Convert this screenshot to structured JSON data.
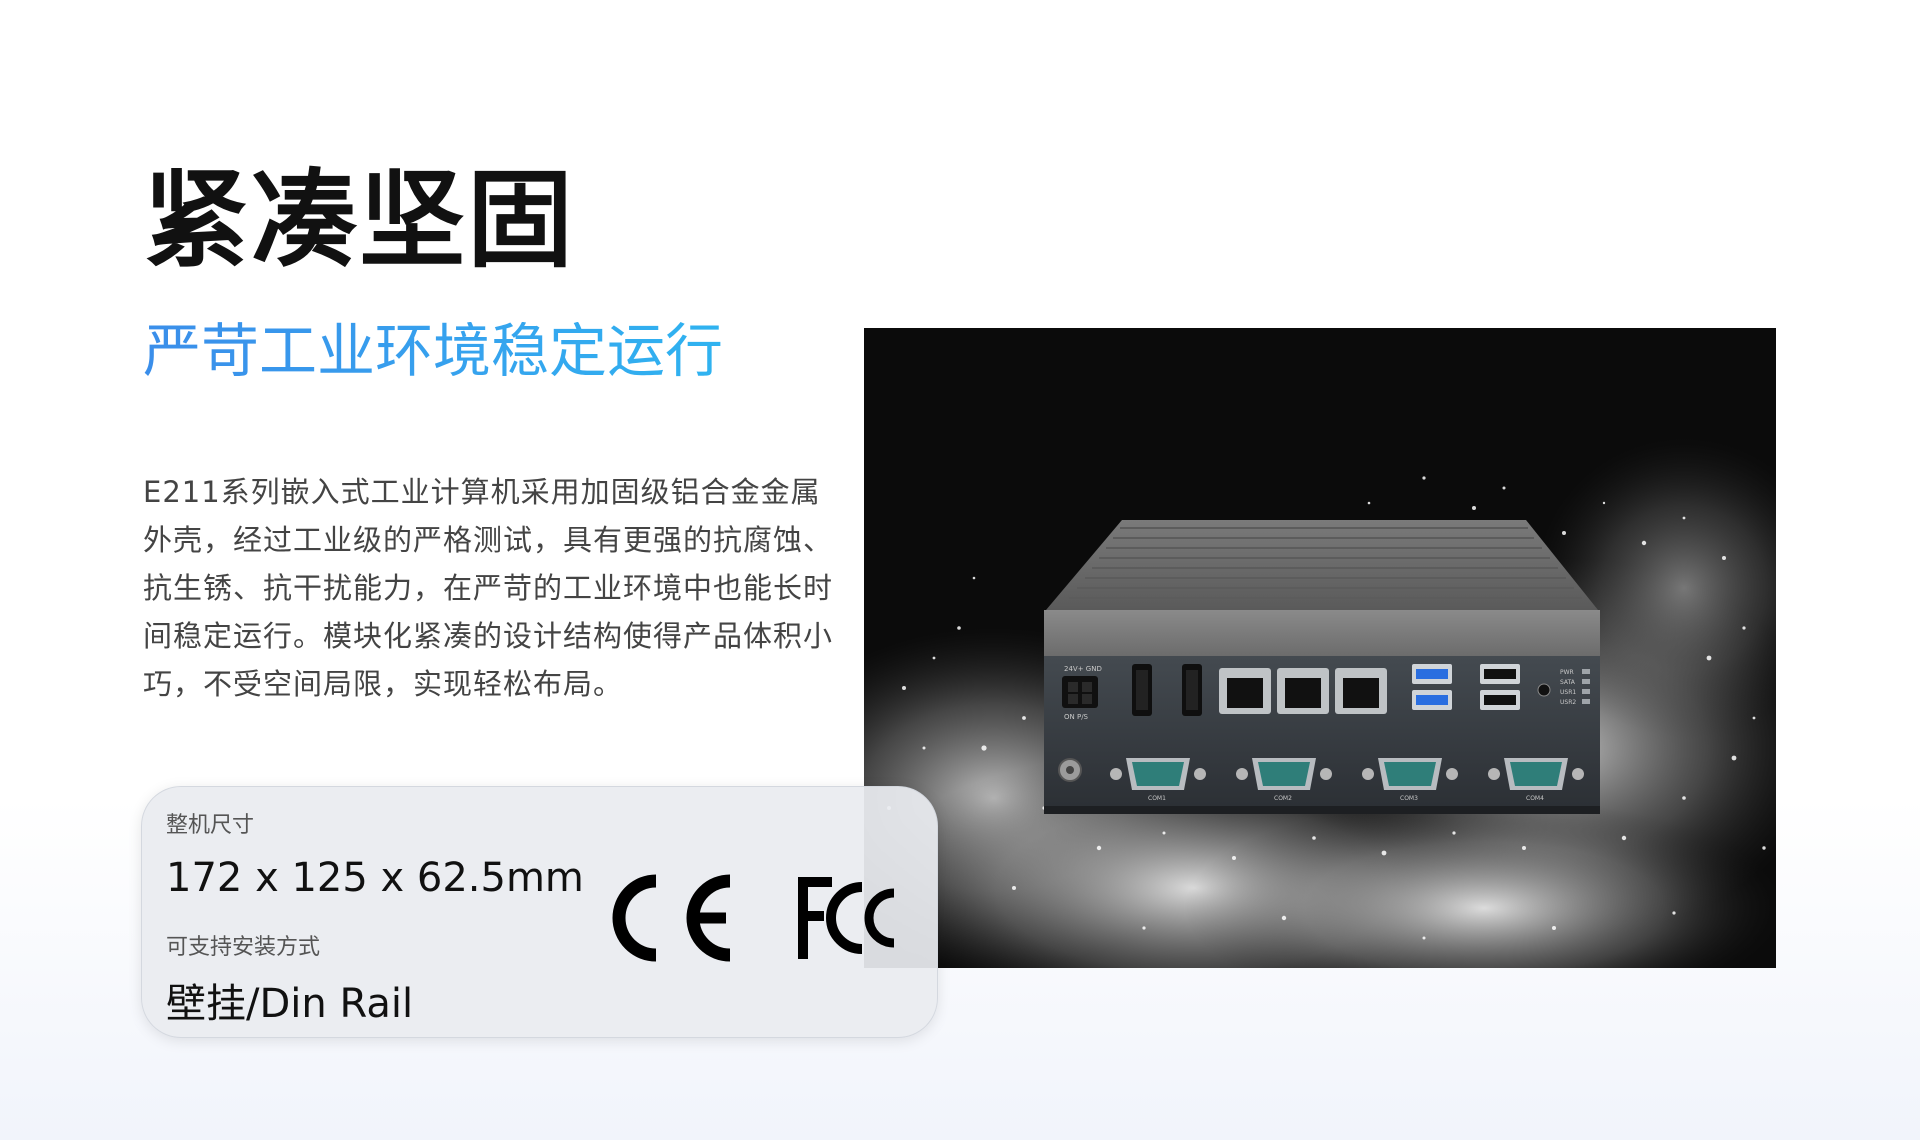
{
  "hero": {
    "title": "紧凑坚固",
    "subtitle": "严苛工业环境稳定运行",
    "description": "E211系列嵌入式工业计算机采用加固级铝合金金属外壳，经过工业级的严格测试，具有更强的抗腐蚀、抗生锈、抗干扰能力，在严苛的工业环境中也能长时间稳定运行。模块化紧凑的设计结构使得产品体积小巧，不受空间局限，实现轻松布局。"
  },
  "specs": {
    "size_label": "整机尺寸",
    "size_value": "172 x 125 x 62.5mm",
    "mount_label": "可支持安装方式",
    "mount_value": "壁挂/Din Rail"
  },
  "certifications": {
    "ce": "ce-logo",
    "fcc": "fcc-logo"
  },
  "product_image": {
    "port_labels": {
      "power_top": "24V+  GND",
      "power_bottom": "ON    P/S",
      "leds": [
        "PWR",
        "SATA",
        "USR1",
        "USR2"
      ],
      "com": [
        "COM1",
        "COM2",
        "COM3",
        "COM4"
      ]
    }
  },
  "colors": {
    "title": "#111111",
    "subtitle_start": "#3a8eea",
    "subtitle_end": "#2fb3f0",
    "body_text": "#444444",
    "photo_background": "#0b0b0b"
  }
}
